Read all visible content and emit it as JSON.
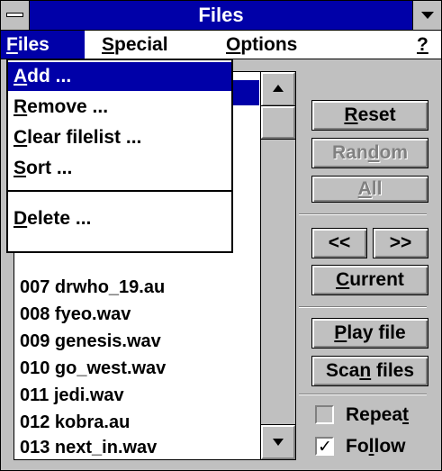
{
  "window": {
    "title": "Files"
  },
  "menubar": {
    "items": [
      {
        "key": "files",
        "pre": "",
        "ul": "F",
        "post": "iles"
      },
      {
        "key": "special",
        "pre": "",
        "ul": "S",
        "post": "pecial"
      },
      {
        "key": "options",
        "pre": "",
        "ul": "O",
        "post": "ptions"
      },
      {
        "key": "help",
        "pre": "",
        "ul": "?",
        "post": ""
      }
    ]
  },
  "files_menu": {
    "items": [
      {
        "pre": "",
        "ul": "A",
        "post": "dd ..."
      },
      {
        "pre": "",
        "ul": "R",
        "post": "emove ..."
      },
      {
        "pre": "",
        "ul": "C",
        "post": "lear filelist ..."
      },
      {
        "pre": "",
        "ul": "S",
        "post": "ort ..."
      },
      {
        "pre": "",
        "ul": "D",
        "post": "elete ..."
      }
    ]
  },
  "filelist": {
    "rows": [
      "007 drwho_19.au",
      "008 fyeo.wav",
      "009 genesis.wav",
      "010 go_west.wav",
      "011 jedi.wav",
      "012 kobra.au",
      "013 next_in.wav"
    ]
  },
  "buttons": {
    "reset": {
      "pre": "",
      "ul": "R",
      "post": "eset"
    },
    "random": {
      "pre": "Ran",
      "ul": "d",
      "post": "om"
    },
    "all": {
      "pre": "",
      "ul": "A",
      "post": "ll"
    },
    "prev": {
      "pre": "<<",
      "ul": "",
      "post": ""
    },
    "next": {
      "pre": ">>",
      "ul": "",
      "post": ""
    },
    "current": {
      "pre": "",
      "ul": "C",
      "post": "urrent"
    },
    "play": {
      "pre": "",
      "ul": "P",
      "post": "lay file"
    },
    "scan": {
      "pre": "Sca",
      "ul": "n",
      "post": " files"
    }
  },
  "checkboxes": {
    "repeat": {
      "pre": "Repea",
      "ul": "t",
      "post": "",
      "checked": false
    },
    "follow": {
      "pre": "Fo",
      "ul": "l",
      "post": "low",
      "checked": true,
      "mark": "✓"
    }
  },
  "colors": {
    "titlebar": "#0000a8",
    "face": "#c0c0c0",
    "highlight": "#0000a8"
  }
}
